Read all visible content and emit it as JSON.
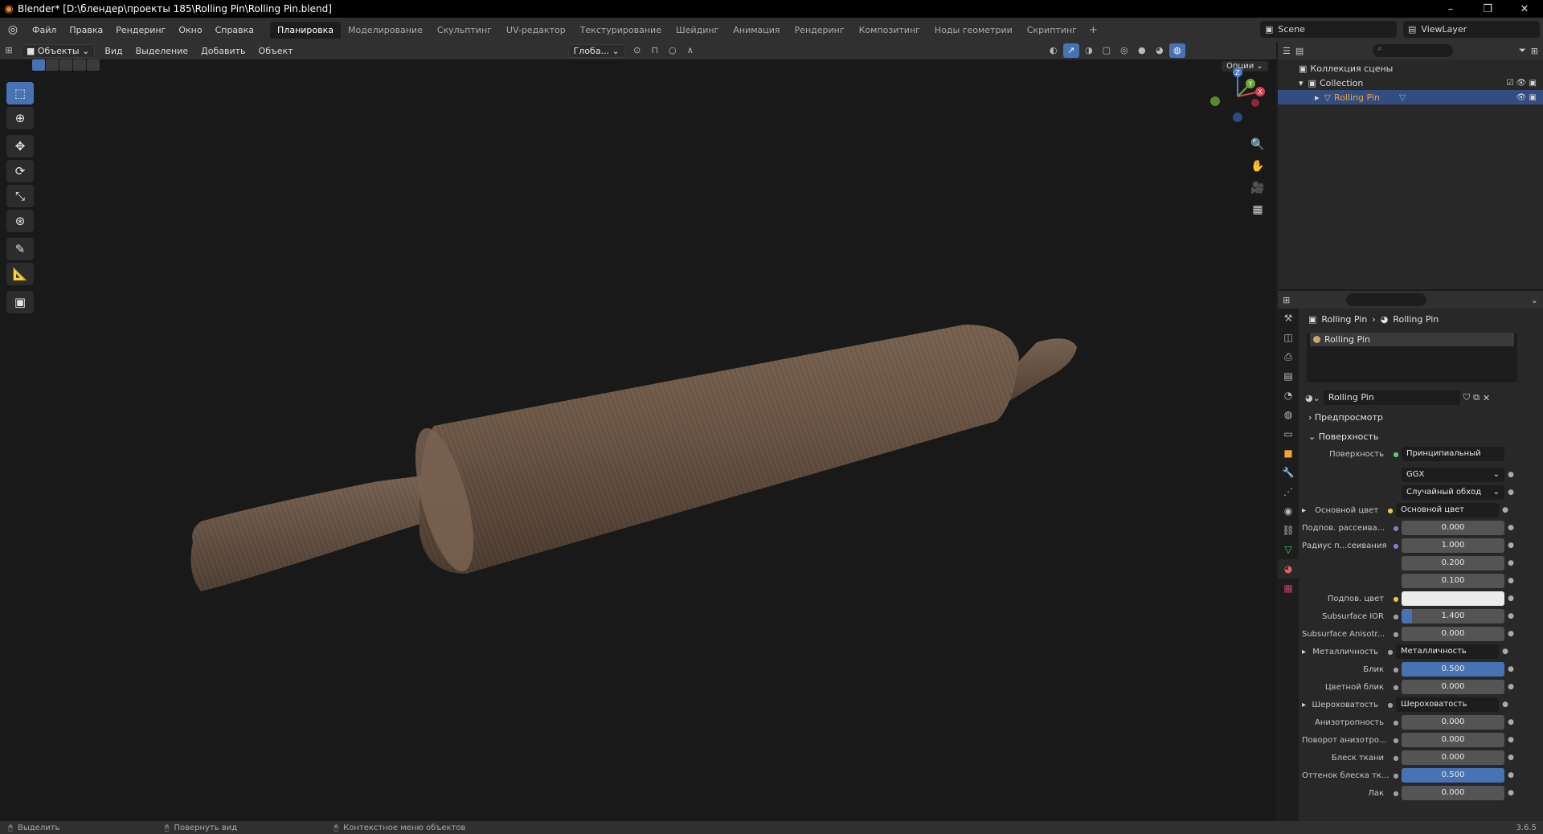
{
  "window": {
    "title": "Blender* [D:\\блендер\\проекты 185\\Rolling Pin\\Rolling Pin.blend]",
    "minimize": "–",
    "maximize": "❐",
    "close": "✕"
  },
  "menus": [
    "Файл",
    "Правка",
    "Рендеринг",
    "Окно",
    "Справка"
  ],
  "workspaces": [
    "Планировка",
    "Моделирование",
    "Скульптинг",
    "UV-редактор",
    "Текстурирование",
    "Шейдинг",
    "Анимация",
    "Рендеринг",
    "Композитинг",
    "Ноды геометрии",
    "Скриптинг"
  ],
  "active_workspace_index": 0,
  "scene": {
    "name": "Scene",
    "view_layer": "ViewLayer"
  },
  "viewport_header": {
    "mode": "Объекты",
    "menus": [
      "Вид",
      "Выделение",
      "Добавить",
      "Объект"
    ],
    "transform_orientation": "Глоба...",
    "options": "Опции"
  },
  "outliner": {
    "scene_collection": "Коллекция сцены",
    "collection": "Collection",
    "object": "Rolling Pin"
  },
  "properties": {
    "breadcrumb": [
      "Rolling Pin",
      "Rolling Pin"
    ],
    "material_slot": "Rolling Pin",
    "material_name": "Rolling Pin",
    "panels": {
      "preview": "Предпросмотр",
      "surface": "Поверхность"
    },
    "surface_label": "Поверхность",
    "surface_shader": "Принципиальный BSDF",
    "distribution": "GGX",
    "subsurface_method": "Случайный обход",
    "rows": [
      {
        "label": "Основной цвет",
        "value": "Основной цвет",
        "kind": "link",
        "expand": true,
        "dot": "#e5c440"
      },
      {
        "label": "Подпов. рассеива...",
        "value": "0.000",
        "kind": "num",
        "fill": 0,
        "dot": "#7f7fd0"
      },
      {
        "label": "Радиус п...сеивания",
        "value": "1.000",
        "kind": "num",
        "fill": 0,
        "dot": "#7f7fd0"
      },
      {
        "label": "",
        "value": "0.200",
        "kind": "num",
        "fill": 0,
        "dot": ""
      },
      {
        "label": "",
        "value": "0.100",
        "kind": "num",
        "fill": 0,
        "dot": ""
      },
      {
        "label": "Подпов. цвет",
        "value": "",
        "kind": "color",
        "fill": 0,
        "dot": "#e5c440"
      },
      {
        "label": "Subsurface IOR",
        "value": "1.400",
        "kind": "num",
        "fill": 0.1,
        "dot": "#a0a0a0"
      },
      {
        "label": "Subsurface Anisotr...",
        "value": "0.000",
        "kind": "num",
        "fill": 0,
        "dot": "#a0a0a0"
      },
      {
        "label": "Металличность",
        "value": "Металличность",
        "kind": "link",
        "expand": true,
        "dot": "#a0a0a0"
      },
      {
        "label": "Блик",
        "value": "0.500",
        "kind": "num",
        "fill": 1,
        "dot": "#a0a0a0"
      },
      {
        "label": "Цветной блик",
        "value": "0.000",
        "kind": "num",
        "fill": 0,
        "dot": "#a0a0a0"
      },
      {
        "label": "Шероховатость",
        "value": "Шероховатость",
        "kind": "link",
        "expand": true,
        "dot": "#a0a0a0"
      },
      {
        "label": "Анизотропность",
        "value": "0.000",
        "kind": "num",
        "fill": 0,
        "dot": "#a0a0a0"
      },
      {
        "label": "Поворот анизотро...",
        "value": "0.000",
        "kind": "num",
        "fill": 0,
        "dot": "#a0a0a0"
      },
      {
        "label": "Блеск ткани",
        "value": "0.000",
        "kind": "num",
        "fill": 0,
        "dot": "#a0a0a0"
      },
      {
        "label": "Оттенок блеска тк...",
        "value": "0.500",
        "kind": "num",
        "fill": 1,
        "dot": "#a0a0a0"
      },
      {
        "label": "Лак",
        "value": "0.000",
        "kind": "num",
        "fill": 0,
        "dot": "#a0a0a0"
      }
    ]
  },
  "status": {
    "select": "Выделить",
    "rotate": "Повернуть вид",
    "context": "Контекстное меню объектов",
    "version": "3.6.5"
  },
  "colors": {
    "accent": "#4772b3",
    "wood": "#6e5a49",
    "viewport_bg": "#191919"
  },
  "icons": {
    "tools": [
      "select-box-icon",
      "cursor-icon",
      "move-icon",
      "rotate-icon",
      "scale-icon",
      "transform-icon",
      "annotate-icon",
      "measure-icon",
      "add-cube-icon"
    ],
    "nav": [
      "zoom-icon",
      "pan-hand-icon",
      "camera-icon",
      "grid-perspective-icon"
    ]
  }
}
